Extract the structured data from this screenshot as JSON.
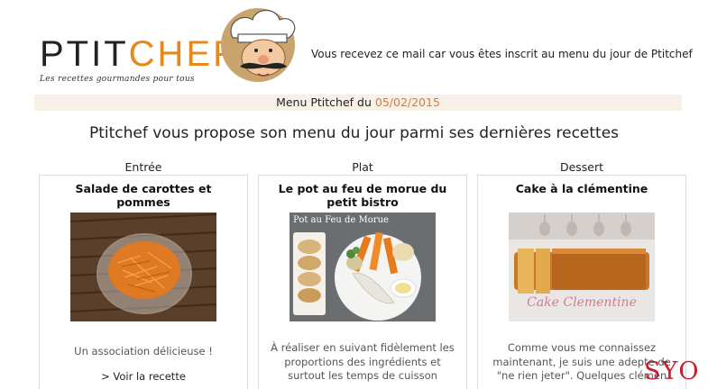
{
  "header": {
    "logo_ptit": "PTIT",
    "logo_chef": "CHEF",
    "tagline": "Les recettes gourmandes pour tous",
    "note": "Vous recevez ce mail car vous êtes inscrit au menu du jour de Ptitchef"
  },
  "menu": {
    "label": "Menu Ptitchef du",
    "date": "05/02/2015"
  },
  "intro": "Ptitchef vous propose son menu du jour parmi ses dernières recettes",
  "columns": [
    {
      "label": "Entrée",
      "title": "Salade de carottes et pommes",
      "image_caption": "",
      "description": "Un association délicieuse !",
      "link": "> Voir la recette"
    },
    {
      "label": "Plat",
      "title": "Le pot au feu de morue du petit bistro",
      "image_caption": "Pot au Feu de Morue",
      "description": "À réaliser en suivant fidèlement les proportions des ingrédients et surtout les temps de cuisson",
      "link": ""
    },
    {
      "label": "Dessert",
      "title": "Cake à la clémentine",
      "image_caption": "Cake Clementine",
      "description": "Comme vous me connaissez maintenant, je suis une adepte de \"ne rien jeter\". Quelques clémen",
      "link": ""
    }
  ],
  "watermark": "SYO",
  "colors": {
    "accent": "#e48a1c",
    "date_color": "#e0783a",
    "date_bar": "#f7f0e6",
    "watermark": "#c81e2e"
  }
}
